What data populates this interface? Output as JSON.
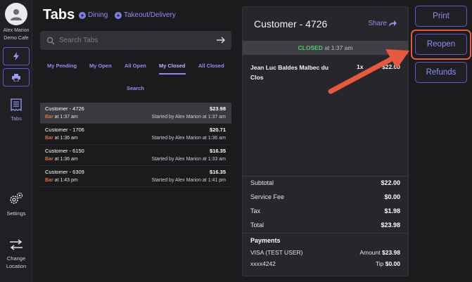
{
  "user": {
    "name": "Alex Marion",
    "place": "Demo Cafe"
  },
  "sidebar": {
    "items": [
      {
        "icon": "lightning-icon"
      },
      {
        "icon": "printer-icon"
      },
      {
        "icon": "receipt-icon",
        "label": "Tabs"
      },
      {
        "icon": "gears-icon",
        "label": "Settings"
      },
      {
        "icon": "swap-arrows-icon",
        "label": "Change Location"
      }
    ]
  },
  "header": {
    "title": "Tabs",
    "links": [
      "Dining",
      "Takeout/Delivery"
    ]
  },
  "search": {
    "placeholder": "Search Tabs"
  },
  "filters": {
    "tabs": [
      "My Pending",
      "My Open",
      "All Open",
      "My Closed",
      "All Closed",
      "Search"
    ],
    "active": "My Closed"
  },
  "tab_list": [
    {
      "name": "Customer - 4726",
      "amount": "$23.98",
      "location": "Bar",
      "time": "at 1:37 am",
      "started": "Started by Alex Marion at 1:37 am"
    },
    {
      "name": "Customer - 1706",
      "amount": "$20.71",
      "location": "Bar",
      "time": "at 1:36 am",
      "started": "Started by Alex Marion at 1:36 am"
    },
    {
      "name": "Customer - 6150",
      "amount": "$16.35",
      "location": "Bar",
      "time": "at 1:36 am",
      "started": "Started by Alex Marion at 1:33 am"
    },
    {
      "name": "Customer - 6309",
      "amount": "$16.35",
      "location": "Bar",
      "time": "at 1:43 pm",
      "started": "Started by Alex Marion at 1:41 pm"
    }
  ],
  "detail": {
    "title": "Customer - 4726",
    "share_label": "Share",
    "status": "CLOSED",
    "status_time": "at 1:37 am",
    "item": {
      "name": "Jean Luc Baldes Malbec du Clos",
      "qty": "1x",
      "price": "$22.00"
    },
    "totals": [
      {
        "label": "Subtotal",
        "value": "$22.00"
      },
      {
        "label": "Service Fee",
        "value": "$0.00"
      },
      {
        "label": "Tax",
        "value": "$1.98"
      },
      {
        "label": "Total",
        "value": "$23.98"
      }
    ],
    "payments": {
      "header": "Payments",
      "method": "VISA (TEST USER)",
      "card": "xxxx4242",
      "amount_label": "Amount",
      "amount": "$23.98",
      "tip_label": "Tip",
      "tip": "$0.00"
    }
  },
  "actions": {
    "print": "Print",
    "reopen": "Reopen",
    "refunds": "Refunds"
  },
  "colors": {
    "accent": "#8f8ff2",
    "closed": "#4ecb6c",
    "bar": "#e36e3c",
    "annotation": "#e8583a"
  }
}
